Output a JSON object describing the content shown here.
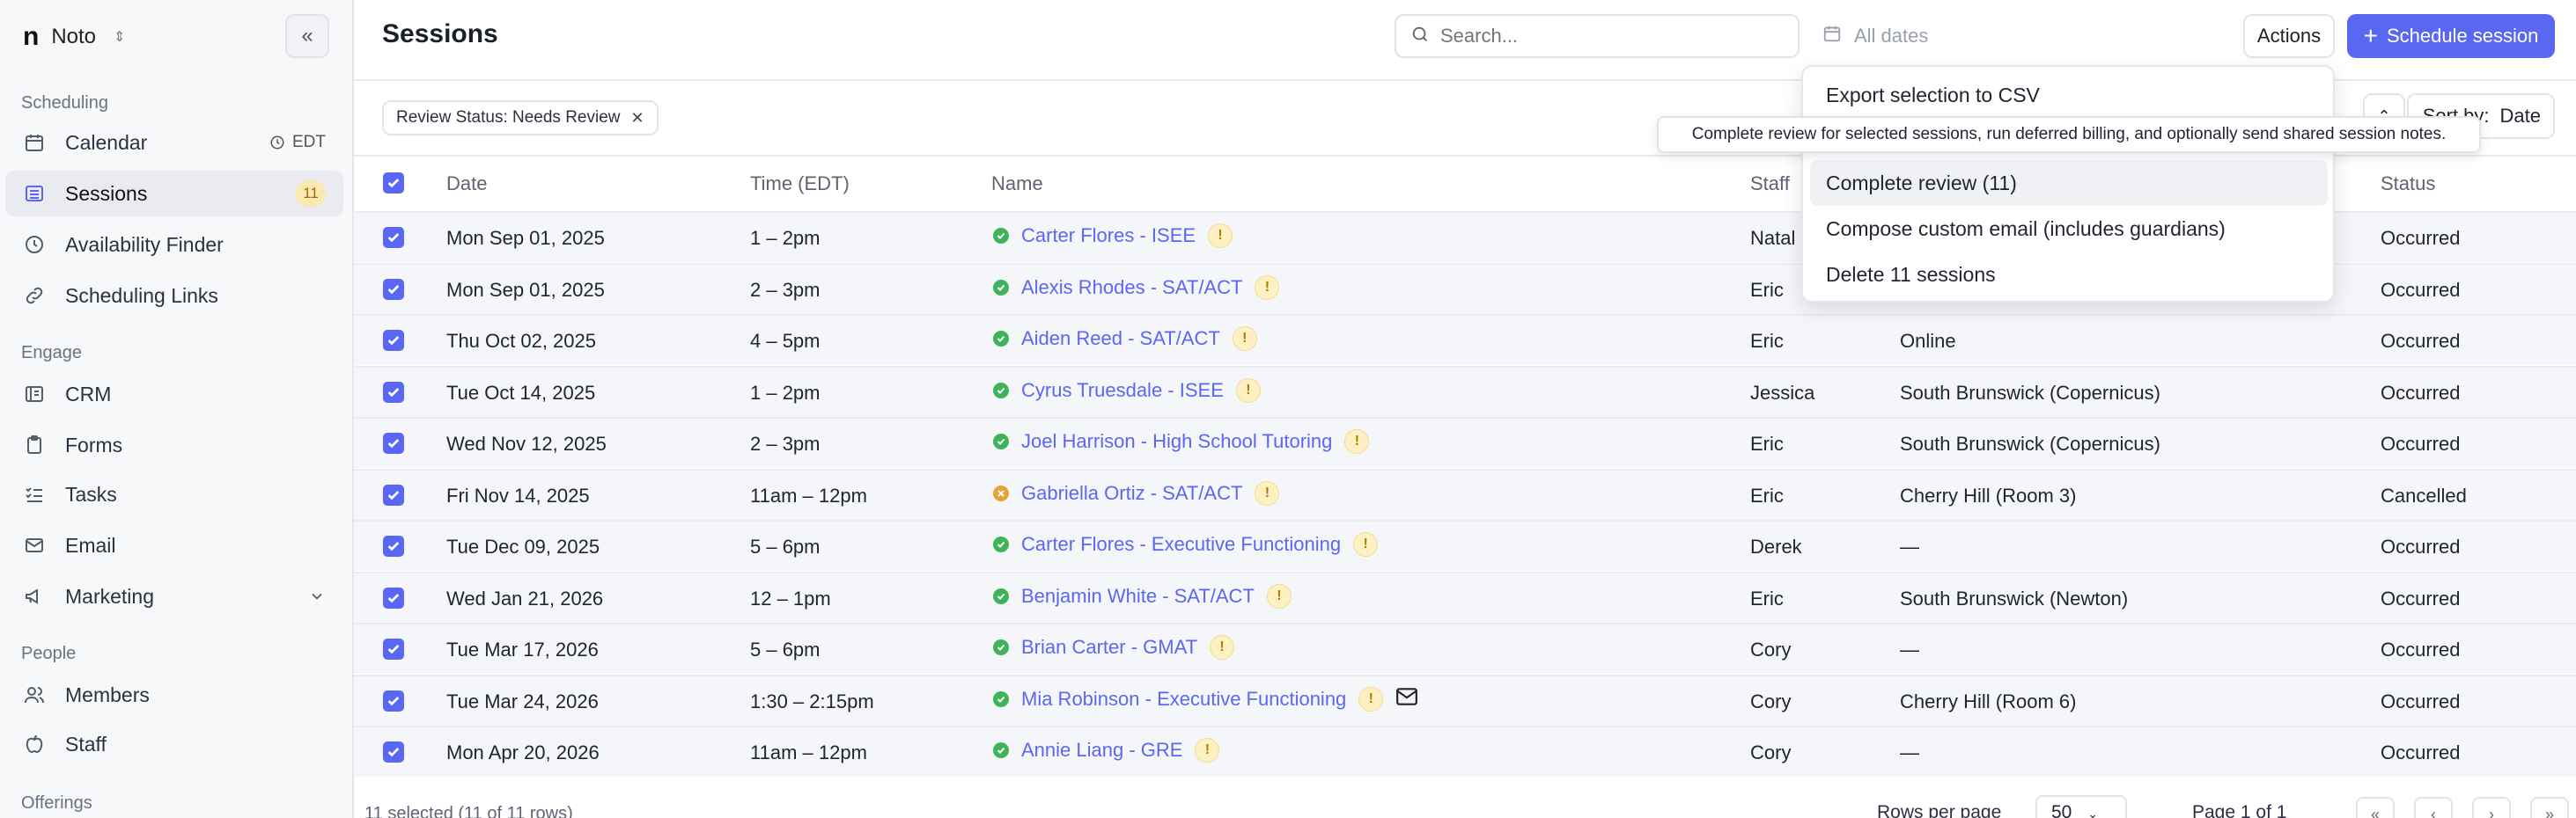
{
  "workspace": {
    "logo": "n",
    "name": "Noto"
  },
  "sidebar": {
    "sections": [
      {
        "label": "Scheduling",
        "items": [
          {
            "label": "Calendar",
            "icon": "calendar-icon",
            "extra": "EDT"
          },
          {
            "label": "Sessions",
            "icon": "list-icon",
            "badge": "11",
            "active": true
          },
          {
            "label": "Availability Finder",
            "icon": "clock-icon"
          },
          {
            "label": "Scheduling Links",
            "icon": "link-icon"
          }
        ]
      },
      {
        "label": "Engage",
        "items": [
          {
            "label": "CRM",
            "icon": "crm-icon"
          },
          {
            "label": "Forms",
            "icon": "clipboard-icon"
          },
          {
            "label": "Tasks",
            "icon": "checklist-icon"
          },
          {
            "label": "Email",
            "icon": "mail-icon"
          },
          {
            "label": "Marketing",
            "icon": "megaphone-icon"
          }
        ]
      },
      {
        "label": "People",
        "items": [
          {
            "label": "Members",
            "icon": "users-icon"
          },
          {
            "label": "Staff",
            "icon": "apple-icon"
          }
        ]
      },
      {
        "label": "Offerings",
        "items": []
      }
    ]
  },
  "header": {
    "title": "Sessions",
    "search_placeholder": "Search...",
    "date_placeholder": "All dates",
    "actions_label": "Actions",
    "primary_label": "Schedule session"
  },
  "filters": {
    "chip": "Review Status: Needs Review",
    "sort_label": "Sort by:",
    "sort_value": "Date"
  },
  "table": {
    "columns": [
      "Date",
      "Time (EDT)",
      "Name",
      "Staff",
      "Status"
    ],
    "rows": [
      {
        "date": "Mon Sep 01, 2025",
        "time": "1 – 2pm",
        "name": "Carter Flores - ISEE",
        "staff": "Natal",
        "location": "",
        "status": "Occurred",
        "state": "ok"
      },
      {
        "date": "Mon Sep 01, 2025",
        "time": "2 – 3pm",
        "name": "Alexis Rhodes - SAT/ACT",
        "staff": "Eric",
        "location": "",
        "status": "Occurred",
        "state": "ok"
      },
      {
        "date": "Thu Oct 02, 2025",
        "time": "4 – 5pm",
        "name": "Aiden Reed - SAT/ACT",
        "staff": "Eric",
        "location": "Online",
        "status": "Occurred",
        "state": "ok"
      },
      {
        "date": "Tue Oct 14, 2025",
        "time": "1 – 2pm",
        "name": "Cyrus Truesdale - ISEE",
        "staff": "Jessica",
        "location": "South Brunswick (Copernicus)",
        "status": "Occurred",
        "state": "ok"
      },
      {
        "date": "Wed Nov 12, 2025",
        "time": "2 – 3pm",
        "name": "Joel Harrison - High School Tutoring",
        "staff": "Eric",
        "location": "South Brunswick (Copernicus)",
        "status": "Occurred",
        "state": "ok"
      },
      {
        "date": "Fri Nov 14, 2025",
        "time": "11am – 12pm",
        "name": "Gabriella Ortiz - SAT/ACT",
        "staff": "Eric",
        "location": "Cherry Hill (Room 3)",
        "status": "Cancelled",
        "state": "cancel"
      },
      {
        "date": "Tue Dec 09, 2025",
        "time": "5 – 6pm",
        "name": "Carter Flores - Executive Functioning",
        "staff": "Derek",
        "location": "—",
        "status": "Occurred",
        "state": "ok"
      },
      {
        "date": "Wed Jan 21, 2026",
        "time": "12 – 1pm",
        "name": "Benjamin White - SAT/ACT",
        "staff": "Eric",
        "location": "South Brunswick (Newton)",
        "status": "Occurred",
        "state": "ok"
      },
      {
        "date": "Tue Mar 17, 2026",
        "time": "5 – 6pm",
        "name": "Brian Carter - GMAT",
        "staff": "Cory",
        "location": "—",
        "status": "Occurred",
        "state": "ok"
      },
      {
        "date": "Tue Mar 24, 2026",
        "time": "1:30 – 2:15pm",
        "name": "Mia Robinson - Executive Functioning",
        "staff": "Cory",
        "location": "Cherry Hill (Room 6)",
        "status": "Occurred",
        "state": "ok",
        "mail": true
      },
      {
        "date": "Mon Apr 20, 2026",
        "time": "11am – 12pm",
        "name": "Annie Liang - GRE",
        "staff": "Cory",
        "location": "—",
        "status": "Occurred",
        "state": "ok"
      }
    ]
  },
  "footer": {
    "selected": "11 selected (11 of 11 rows)",
    "rows_per_page_label": "Rows per page",
    "rows_per_page": "50",
    "page_label": "Page 1 of 1"
  },
  "dropdown": {
    "items": [
      "Export selection to CSV",
      "Complete review (11)",
      "Compose custom email (includes guardians)",
      "Delete 11 sessions"
    ],
    "tooltip": "Complete review for selected sessions, run deferred billing, and optionally send shared session notes."
  },
  "colors": {
    "accent": "#5a67f2",
    "ok": "#3fb35a",
    "cancel": "#e9a23b",
    "warn_bg": "#fdf1c4"
  }
}
